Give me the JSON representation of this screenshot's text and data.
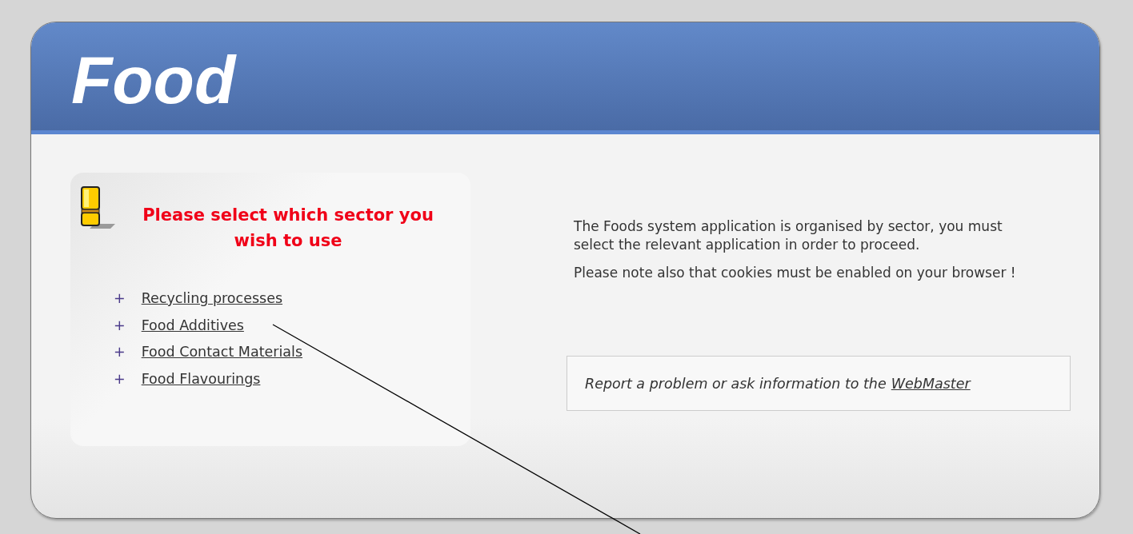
{
  "header": {
    "title": "Food"
  },
  "sector_panel": {
    "heading": "Please select which sector you wish to use",
    "items": [
      {
        "bullet": "+",
        "label": "Recycling processes"
      },
      {
        "bullet": "+",
        "label": "Food Additives"
      },
      {
        "bullet": "+",
        "label": "Food Contact Materials"
      },
      {
        "bullet": "+",
        "label": "Food Flavourings"
      }
    ]
  },
  "info": {
    "paragraphs": [
      "The Foods system application is organised by sector, you must select the relevant application in order to proceed.",
      "Please note also that cookies must be enabled on your browser !"
    ]
  },
  "contact": {
    "text": "Report a problem or ask information to the",
    "link": "WebMaster"
  }
}
